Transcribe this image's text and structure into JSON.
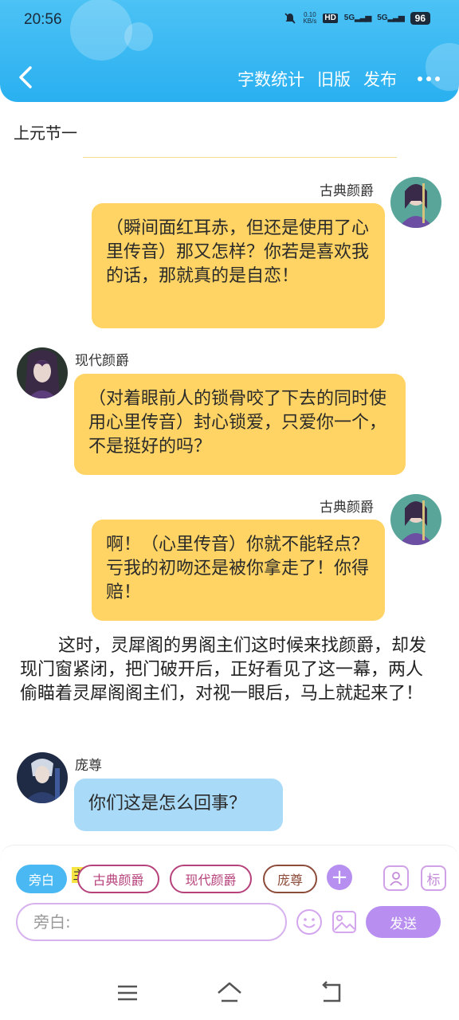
{
  "status_bar": {
    "time": "20:56",
    "net_speed_value": "0.10",
    "net_speed_unit": "KB/s",
    "hd_label": "HD",
    "signal1": "5G",
    "signal2": "5G",
    "battery": "96"
  },
  "header": {
    "accent_color": "#2ab0f0",
    "actions": {
      "word_count": "字数统计",
      "old_version": "旧版",
      "publish": "发布"
    }
  },
  "chapter": {
    "title": "上元节一"
  },
  "messages": [
    {
      "speaker": "古典颜爵",
      "side": "right",
      "text": "（瞬间面红耳赤，但还是使用了心里传音）那又怎样？你若是喜欢我的话，那就真的是自恋！",
      "color": "#ffd464"
    },
    {
      "speaker": "现代颜爵",
      "side": "left",
      "text": "（对着眼前人的锁骨咬了下去的同时使用心里传音）封心锁爱，只爱你一个，不是挺好的吗？",
      "color": "#ffd464"
    },
    {
      "speaker": "古典颜爵",
      "side": "right",
      "text": "啊！（心里传音）你就不能轻点？亏我的初吻还是被你拿走了！你得赔！",
      "color": "#ffd464"
    },
    {
      "narration": "这时，灵犀阁的男阁主们这时候来找颜爵，却发现门窗紧闭，把门破开后，正好看见了这一幕，两人偷瞄着灵犀阁阁主们，对视一眼后，马上就起来了！"
    },
    {
      "speaker": "庞尊",
      "side": "left",
      "text": "你们这是怎么回事？",
      "color": "#a9daf7"
    }
  ],
  "composer": {
    "role_chips": [
      "旁白",
      "古典颜爵",
      "现代颜爵",
      "庞尊"
    ],
    "main_mark": "主",
    "input_placeholder": "旁白:",
    "send_label": "发送",
    "mark_icon_label": "标",
    "icons": [
      "add-role-icon",
      "contact-icon",
      "mark-icon",
      "emoji-icon",
      "image-icon"
    ]
  },
  "nav": {
    "icons": [
      "menu-icon",
      "home-icon",
      "back-icon"
    ]
  }
}
